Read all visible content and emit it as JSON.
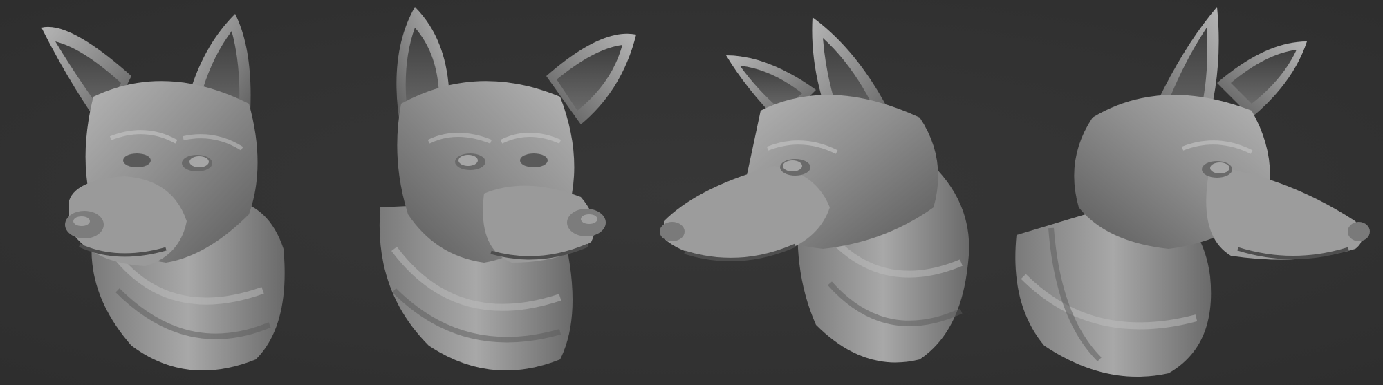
{
  "scene": {
    "background_color": "#323232",
    "sculpt_base_color": "#8e8e8e",
    "sculpt_highlight_color": "#c4c4c4",
    "sculpt_shadow_color": "#4a4a4a",
    "views": [
      {
        "name": "three-quarter-left-view",
        "subject": "dog-head-sculpt"
      },
      {
        "name": "three-quarter-right-view",
        "subject": "dog-head-sculpt"
      },
      {
        "name": "left-profile-view",
        "subject": "dog-head-sculpt"
      },
      {
        "name": "right-profile-view",
        "subject": "dog-head-sculpt"
      }
    ]
  }
}
